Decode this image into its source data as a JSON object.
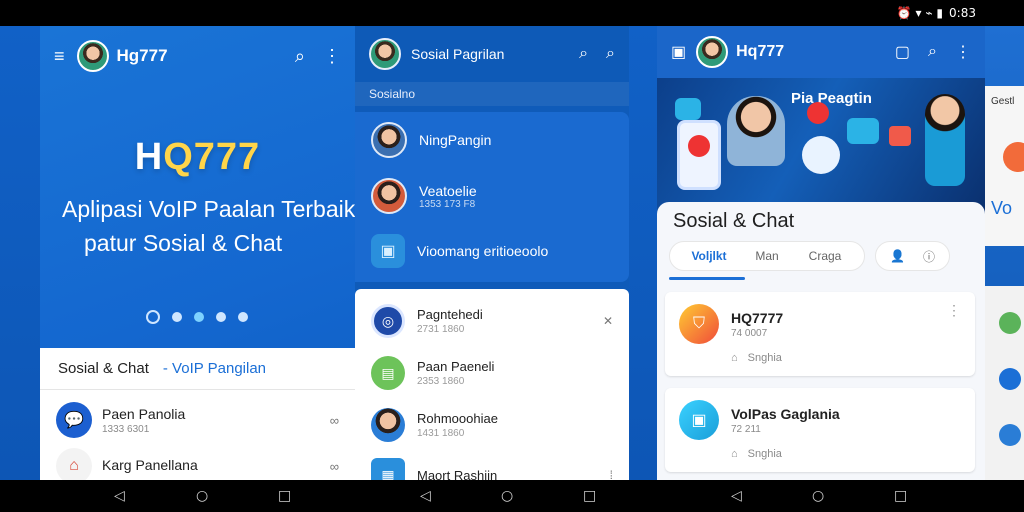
{
  "status_bar": {
    "time": "0:83",
    "right_glyphs": "⏰ ▾ ⌁ ▮"
  },
  "panel1": {
    "title": "Hg777",
    "logo_parts": [
      "H",
      "Q777"
    ],
    "hero_line1": "Aplipasi VoIP Paalan Terbaik",
    "hero_line2": "patur Sosial & Chat",
    "tabs": [
      "Sosial & Chat",
      "- VoIP Pangilan"
    ],
    "rows": [
      {
        "name": "Paen Panolia",
        "sub": "1333  6301",
        "end": "∞"
      },
      {
        "name": "Karg Panellana",
        "sub": "",
        "end": "∞"
      }
    ]
  },
  "panel2": {
    "title": "Sosial Pagrilan",
    "section": "Sosialno",
    "blue_items": [
      {
        "name": "NingPangin",
        "sub": ""
      },
      {
        "name": "Veatoelie",
        "sub": "1353  173 F8"
      },
      {
        "name": "Vioomang eritioeoolo",
        "sub": ""
      }
    ],
    "white_items": [
      {
        "name": "Pagntehedi",
        "sub": "2731  1860",
        "end": "✕"
      },
      {
        "name": "Paan Paeneli",
        "sub": "2353  1860",
        "end": ""
      },
      {
        "name": "Rohmooohiae",
        "sub": "1431  1860",
        "end": ""
      },
      {
        "name": "Maort Rashiin",
        "sub": "",
        "end": "⁞"
      }
    ]
  },
  "panel3": {
    "title": "Hq777",
    "banner_title": "Pia Peagtin",
    "sheet_title": "Sosial & Chat",
    "tabs": [
      "Voljlkt",
      "Man",
      "Craga"
    ],
    "cards": [
      {
        "name": "HQ7777",
        "sub": "74  0007",
        "meta": "Snghia"
      },
      {
        "name": "VolPas Gaglania",
        "sub": "72  211",
        "meta": "Snghia"
      }
    ]
  },
  "panel4": {
    "fragment_top": "Gestl",
    "fragment_big": "Vo"
  }
}
